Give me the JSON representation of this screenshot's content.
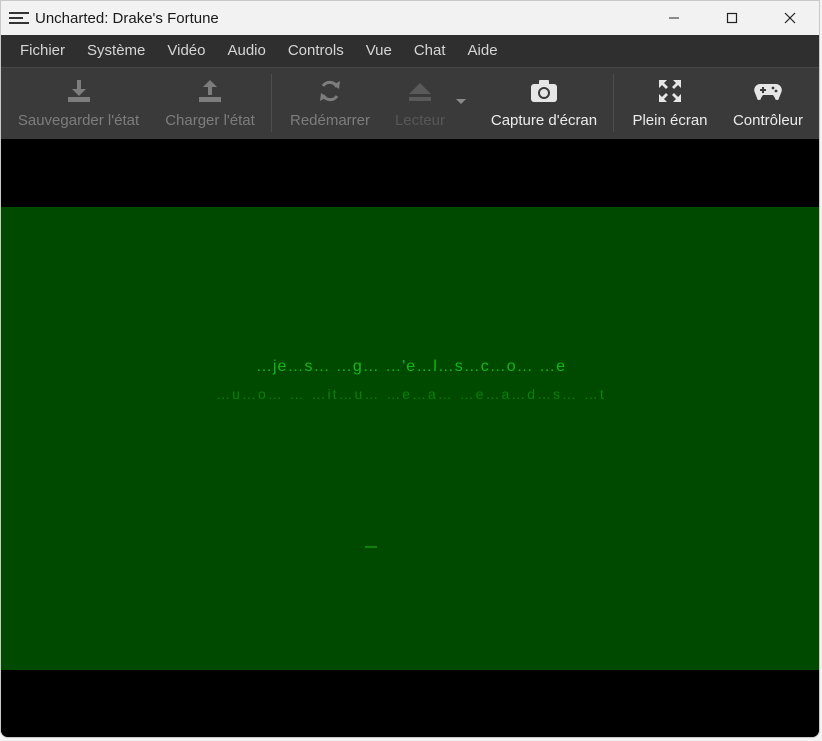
{
  "window": {
    "title": "Uncharted: Drake's Fortune",
    "controls": [
      "minimize",
      "maximize",
      "close"
    ]
  },
  "menu": {
    "items": [
      "Fichier",
      "Système",
      "Vidéo",
      "Audio",
      "Controls",
      "Vue",
      "Chat",
      "Aide"
    ]
  },
  "toolbar": {
    "save_state": {
      "label": "Sauvegarder l'état",
      "icon": "download-icon",
      "enabled": false
    },
    "load_state": {
      "label": "Charger l'état",
      "icon": "upload-icon",
      "enabled": false
    },
    "restart": {
      "label": "Redémarrer",
      "icon": "refresh-icon",
      "enabled": false
    },
    "drive": {
      "label": "Lecteur",
      "icon": "eject-icon",
      "enabled": false
    },
    "screenshot": {
      "label": "Capture d'écran",
      "icon": "camera-icon",
      "enabled": true
    },
    "fullscreen": {
      "label": "Plein écran",
      "icon": "expand-icon",
      "enabled": true
    },
    "controller": {
      "label": "Contrôleur",
      "icon": "gamepad-icon",
      "enabled": true
    }
  },
  "game": {
    "line1": "…je…s…  …g…  …'e…l…s…c…o…  …e",
    "line2": "…u…o…  …  …it…u…  …e…a…  …e…a…d…s…  …t",
    "bg_color": "#004a00",
    "text_color": "#19c21a"
  }
}
